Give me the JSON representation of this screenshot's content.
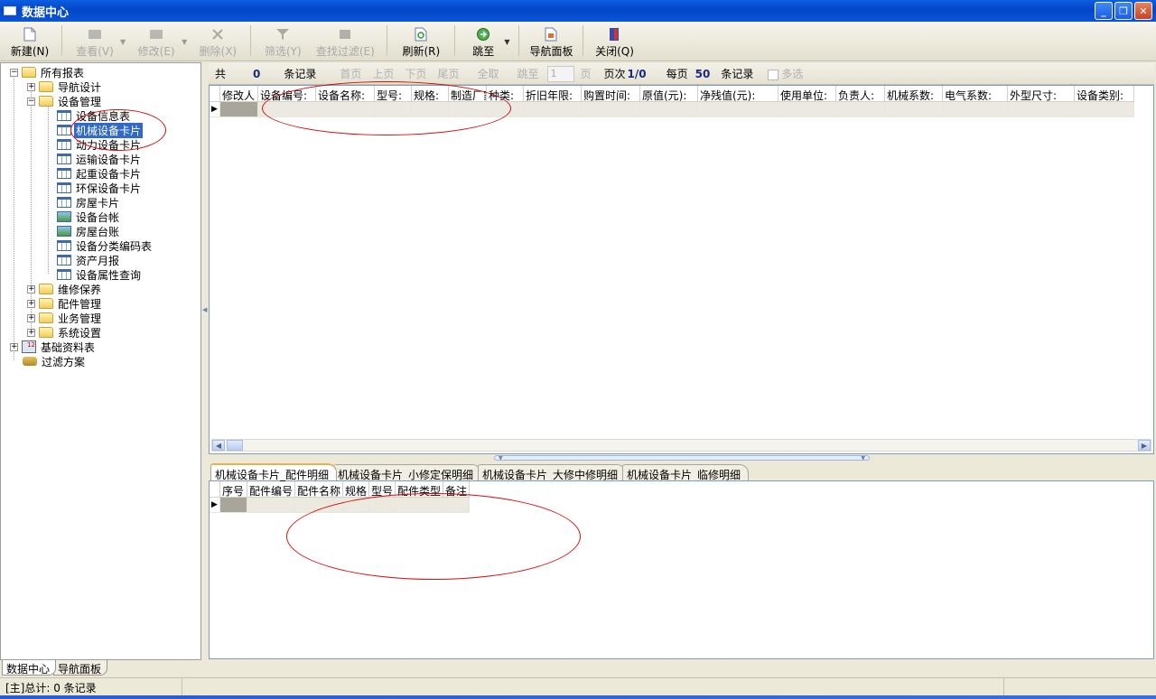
{
  "window": {
    "title": "数据中心"
  },
  "toolbar": {
    "buttons": [
      {
        "label": "新建(N)",
        "enabled": true,
        "icon": "new-document-icon"
      },
      {
        "label": "查看(V)",
        "enabled": false,
        "icon": "view-icon"
      },
      {
        "label": "修改(E)",
        "enabled": false,
        "icon": "edit-icon"
      },
      {
        "label": "删除(X)",
        "enabled": false,
        "icon": "delete-icon"
      },
      {
        "label": "筛选(Y)",
        "enabled": false,
        "icon": "filter-icon"
      },
      {
        "label": "查找过滤(E)",
        "enabled": false,
        "icon": "find-filter-icon"
      },
      {
        "label": "刷新(R)",
        "enabled": true,
        "icon": "refresh-icon"
      },
      {
        "label": "跳至",
        "enabled": true,
        "icon": "goto-icon"
      },
      {
        "label": "导航面板",
        "enabled": true,
        "icon": "nav-panel-icon"
      },
      {
        "label": "关闭(Q)",
        "enabled": true,
        "icon": "close-door-icon"
      }
    ]
  },
  "tree": {
    "items": [
      {
        "label": "所有报表",
        "level": 0,
        "icon": "folder",
        "expander": "−"
      },
      {
        "label": "导航设计",
        "level": 1,
        "icon": "folder",
        "expander": "+"
      },
      {
        "label": "设备管理",
        "level": 1,
        "icon": "folder",
        "expander": "−"
      },
      {
        "label": "设备信息表",
        "level": 2,
        "icon": "grid"
      },
      {
        "label": "机械设备卡片",
        "level": 2,
        "icon": "grid",
        "selected": true
      },
      {
        "label": "动力设备卡片",
        "level": 2,
        "icon": "grid"
      },
      {
        "label": "运输设备卡片",
        "level": 2,
        "icon": "grid"
      },
      {
        "label": "起重设备卡片",
        "level": 2,
        "icon": "grid"
      },
      {
        "label": "环保设备卡片",
        "level": 2,
        "icon": "grid"
      },
      {
        "label": "房屋卡片",
        "level": 2,
        "icon": "grid"
      },
      {
        "label": "设备台帐",
        "level": 2,
        "icon": "photo"
      },
      {
        "label": "房屋台账",
        "level": 2,
        "icon": "photo"
      },
      {
        "label": "设备分类编码表",
        "level": 2,
        "icon": "grid"
      },
      {
        "label": "资产月报",
        "level": 2,
        "icon": "grid"
      },
      {
        "label": "设备属性查询",
        "level": 2,
        "icon": "grid"
      },
      {
        "label": "维修保养",
        "level": 1,
        "icon": "folder",
        "expander": "+"
      },
      {
        "label": "配件管理",
        "level": 1,
        "icon": "folder",
        "expander": "+"
      },
      {
        "label": "业务管理",
        "level": 1,
        "icon": "folder",
        "expander": "+"
      },
      {
        "label": "系统设置",
        "level": 1,
        "icon": "folder",
        "expander": "+"
      },
      {
        "label": "基础资料表",
        "level": 0,
        "icon": "table",
        "expander": "+"
      },
      {
        "label": "过滤方案",
        "level": 0,
        "icon": "key"
      }
    ]
  },
  "pager": {
    "total_prefix": "共",
    "total_count": "0",
    "total_suffix": "条记录",
    "first": "首页",
    "prev": "上页",
    "next": "下页",
    "last": "尾页",
    "all": "全取",
    "goto": "跳至",
    "page_input": "1",
    "page_unit": "页",
    "page_label": "页次",
    "page_value": "1/0",
    "per_page_label": "每页",
    "per_page_value": "50",
    "per_page_suffix": "条记录",
    "multi_select": "多选"
  },
  "main_grid": {
    "columns": [
      "修改人",
      "设备编号:",
      "设备名称:",
      "型号:",
      "规格:",
      "制造厂家",
      "种类:",
      "折旧年限:",
      "购置时间:",
      "原值(元):",
      "净残值(元):",
      "使用单位:",
      "负责人:",
      "机械系数:",
      "电气系数:",
      "外型尺寸:",
      "设备类别:"
    ]
  },
  "detail_tabs": [
    "机械设备卡片_配件明细",
    "机械设备卡片_小修定保明细",
    "机械设备卡片_大修中修明细",
    "机械设备卡片_临修明细"
  ],
  "detail_grid": {
    "columns": [
      "序号",
      "配件编号",
      "配件名称",
      "规格",
      "型号",
      "配件类型",
      "备注"
    ]
  },
  "bottom_tabs": [
    "数据中心",
    "导航面板"
  ],
  "status": {
    "text": "[主]总计: 0 条记录"
  },
  "colors": {
    "selection": "#316ac5",
    "annotation": "#d01010",
    "titlebar": "#0a5fe0"
  }
}
